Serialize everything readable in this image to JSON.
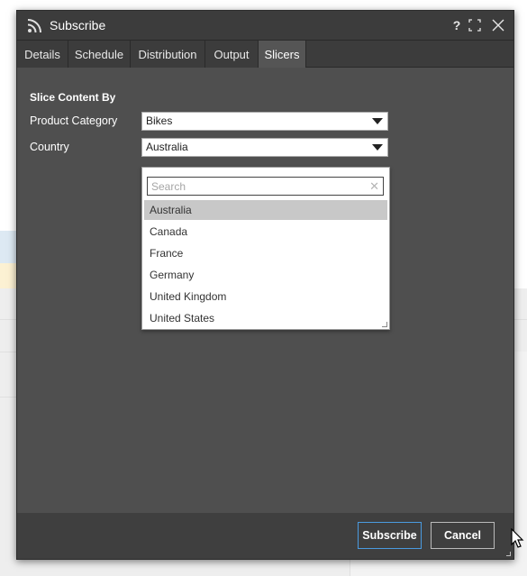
{
  "window": {
    "title": "Subscribe",
    "help_label": "?",
    "maximize_icon": "maximize-icon",
    "close_icon": "close-icon"
  },
  "tabs": [
    {
      "label": "Details",
      "active": false
    },
    {
      "label": "Schedule",
      "active": false
    },
    {
      "label": "Distribution",
      "active": false
    },
    {
      "label": "Output",
      "active": false
    },
    {
      "label": "Slicers",
      "active": true
    }
  ],
  "slicers": {
    "section_title": "Slice Content By",
    "product_category": {
      "label": "Product Category",
      "value": "Bikes"
    },
    "country": {
      "label": "Country",
      "value": "Australia"
    }
  },
  "dropdown": {
    "search_placeholder": "Search",
    "search_value": "",
    "options": [
      "Australia",
      "Canada",
      "France",
      "Germany",
      "United Kingdom",
      "United States"
    ],
    "selected": "Australia"
  },
  "footer": {
    "subscribe_label": "Subscribe",
    "cancel_label": "Cancel"
  },
  "colors": {
    "dialog_bg": "#4f4f4f",
    "titlebar_bg": "#3c3c3c",
    "primary_border": "#4a9be0",
    "selected_option_bg": "#c8c8c8"
  }
}
